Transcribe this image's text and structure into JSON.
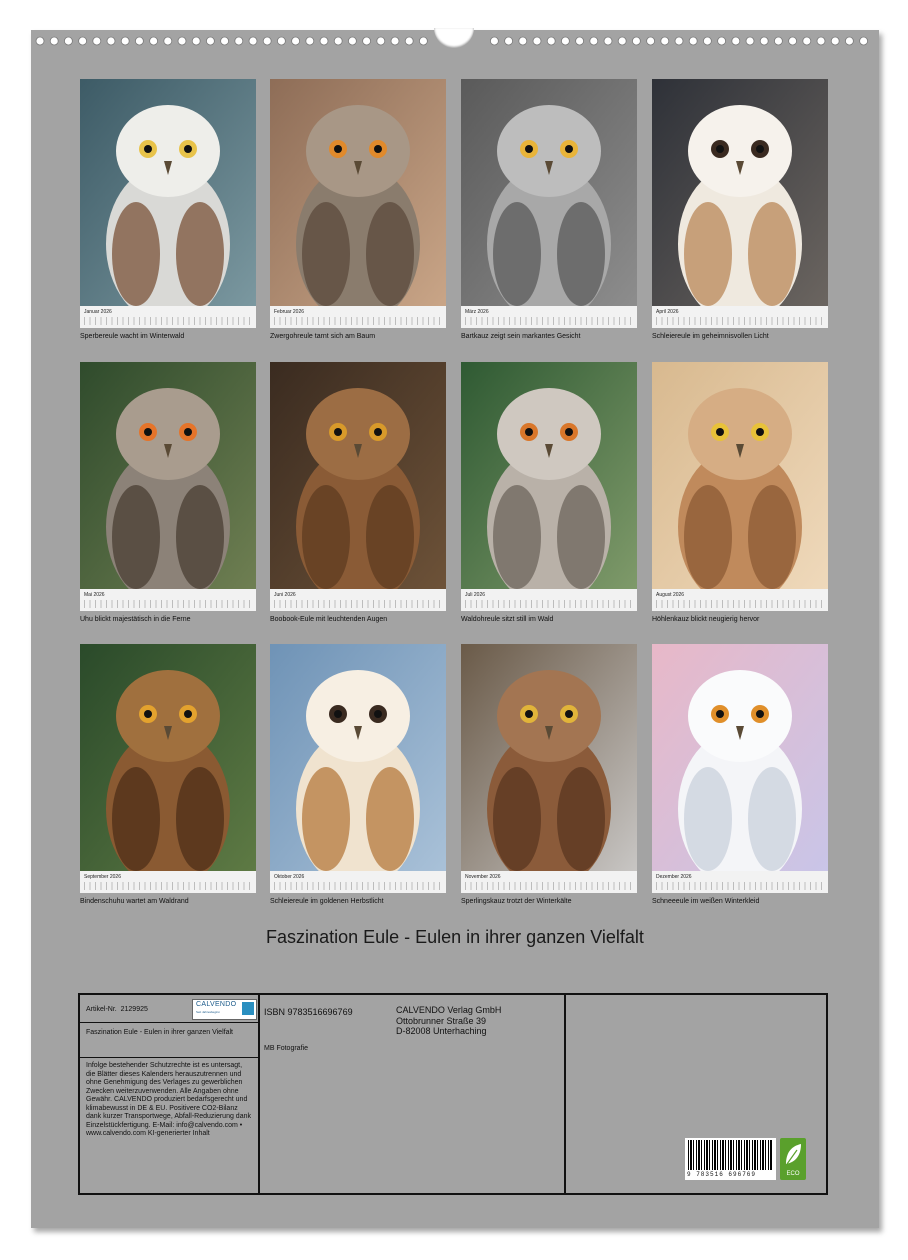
{
  "title": "Faszination Eule - Eulen in ihrer ganzen Vielfalt",
  "months": [
    {
      "name": "Januar 2026",
      "caption": "Sperbereule wacht im Winterwald"
    },
    {
      "name": "Februar 2026",
      "caption": "Zwergohreule tarnt sich am Baum"
    },
    {
      "name": "März 2026",
      "caption": "Bartkauz zeigt sein markantes Gesicht"
    },
    {
      "name": "April 2026",
      "caption": "Schleiereule im geheimnisvollen Licht"
    },
    {
      "name": "Mai 2026",
      "caption": "Uhu blickt majestätisch in die Ferne"
    },
    {
      "name": "Juni 2026",
      "caption": "Boobook-Eule mit leuchtenden Augen"
    },
    {
      "name": "Juli 2026",
      "caption": "Waldohreule sitzt still im Wald"
    },
    {
      "name": "August 2026",
      "caption": "Höhlenkauz blickt neugierig hervor"
    },
    {
      "name": "September 2026",
      "caption": "Bindenschuhu wartet am Waldrand"
    },
    {
      "name": "Oktober 2026",
      "caption": "Schleiereule im goldenen Herbstlicht"
    },
    {
      "name": "November 2026",
      "caption": "Sperlingskauz trotzt der Winterkälte"
    },
    {
      "name": "Dezember 2026",
      "caption": "Schneeeule im weißen Winterkleid"
    }
  ],
  "info": {
    "article_label": "Artikel-Nr.",
    "article_no": "2129925",
    "logo_text": "CALVENDO",
    "logo_sub": "Seit Jahresbeginn",
    "book_title": "Faszination Eule - Eulen in ihrer ganzen Vielfalt",
    "legal": "Infolge bestehender Schutzrechte ist es untersagt, die Blätter dieses Kalenders herauszutrennen und ohne Genehmigung des Verlages zu gewerblichen Zwecken weiterzuverwenden. Alle Angaben ohne Gewähr. CALVENDO produziert bedarfsgerecht und klimabewusst in DE & EU. Positivere CO2-Bilanz dank kurzer Transportwege, Abfall-Reduzierung dank Einzelstückfertigung. E-Mail: info@calvendo.com • www.calvendo.com KI-generierter Inhalt",
    "isbn": "ISBN 9783516696769",
    "author": "MB Fotografie",
    "publisher": "CALVENDO Verlag GmbH",
    "street": "Ottobrunner Straße 39",
    "city": "D-82008 Unterhaching",
    "barcode_number": "9 783516 696769",
    "eco_label": "ECO"
  }
}
